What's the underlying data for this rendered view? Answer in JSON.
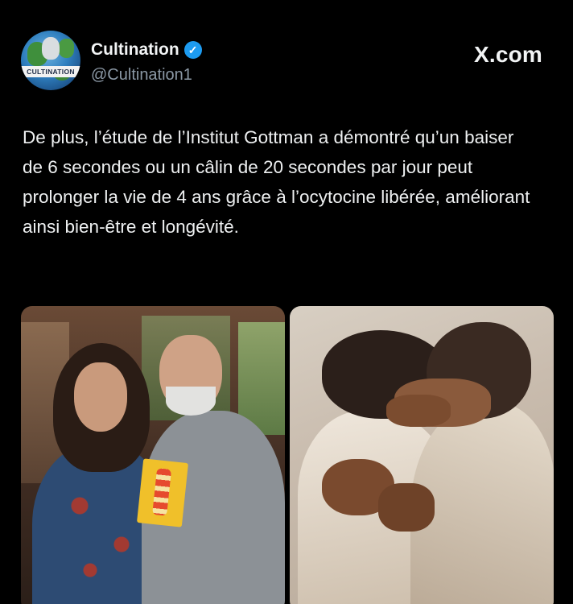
{
  "account": {
    "avatar_text": "CULTINATION",
    "display_name": "Cultination",
    "verified_glyph": "✓",
    "handle": "@Cultination1"
  },
  "brand": "X.com",
  "tweet": {
    "text": "De plus, l’étude de l’Institut Gottman a démontré qu’un baiser de 6 secondes ou un câlin de 20 secondes par jour peut prolonger la vie de 4 ans grâce à l’ocytocine libérée, améliorant ainsi bien-être et longévité."
  },
  "colors": {
    "background": "#000000",
    "verified_badge": "#1d9bf0",
    "handle": "#8b98a5"
  },
  "icons": {
    "verified": "verified-badge-icon"
  }
}
